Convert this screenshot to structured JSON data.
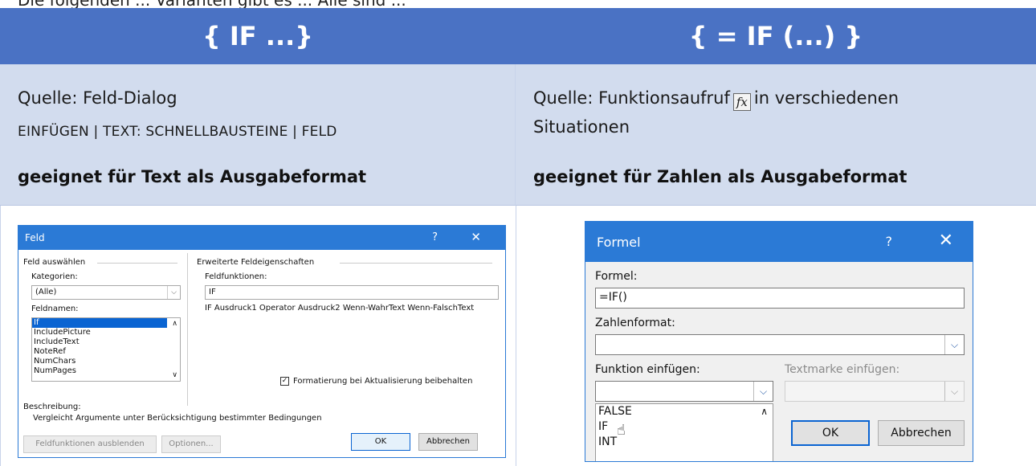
{
  "top_fragment": "Die folgenden ... Varianten gibt es ... Alle sind ... ",
  "left": {
    "header": "{ IF ...}",
    "source_line": "Quelle: Feld-Dialog",
    "menu_path": "EINFÜGEN | TEXT: SCHNELLBAUSTEINE | FELD",
    "suitability": "geeignet für Text als Ausgabeformat"
  },
  "right": {
    "header": "{ = IF (...) }",
    "source_line_a": "Quelle: Funktionsaufruf",
    "fx_icon": "fx-icon",
    "source_line_b": "in verschiedenen",
    "source_line_c": "Situationen",
    "suitability": "geeignet für Zahlen als Ausgabeformat"
  },
  "feld_dialog": {
    "title": "Feld",
    "help": "?",
    "close": "✕",
    "group_select": "Feld auswählen",
    "kategorien_label": "Kategorien:",
    "kategorien_value": "(Alle)",
    "feldnamen_label": "Feldnamen:",
    "feldnamen": [
      "If",
      "IncludePicture",
      "IncludeText",
      "NoteRef",
      "NumChars",
      "NumPages"
    ],
    "group_extended": "Erweiterte Feldeigenschaften",
    "feldfunktionen_label": "Feldfunktionen:",
    "feldfunktionen_value": "IF",
    "syntax": "IF Ausdruck1 Operator Ausdruck2 Wenn-WahrText Wenn-FalschText",
    "checkbox_label": "Formatierung bei Aktualisierung beibehalten",
    "beschreibung_label": "Beschreibung:",
    "beschreibung_text": "Vergleicht Argumente unter Berücksichtigung bestimmter Bedingungen",
    "btn_hide": "Feldfunktionen ausblenden",
    "btn_options": "Optionen...",
    "btn_ok": "OK",
    "btn_cancel": "Abbrechen"
  },
  "formel_dialog": {
    "title": "Formel",
    "help": "?",
    "close": "✕",
    "formel_label": "Formel:",
    "formel_value": "=IF()",
    "zahlenformat_label": "Zahlenformat:",
    "zahlenformat_value": "",
    "funktion_label": "Funktion einfügen:",
    "textmarke_label": "Textmarke einfügen:",
    "functions": [
      "FALSE",
      "IF",
      "INT"
    ],
    "btn_ok": "OK",
    "btn_cancel": "Abbrechen"
  }
}
